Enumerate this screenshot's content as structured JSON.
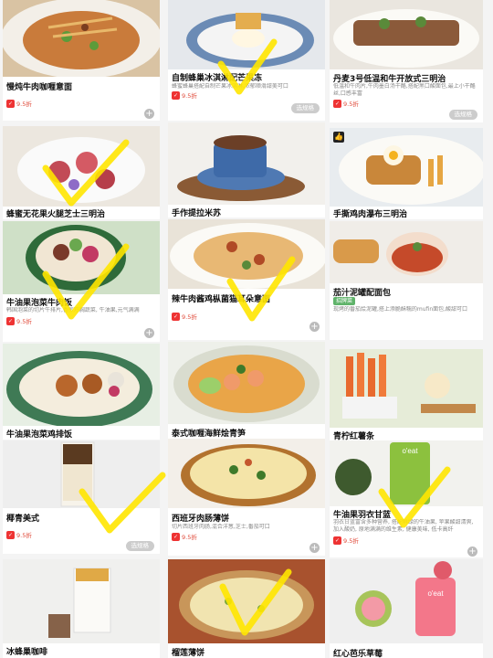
{
  "discount_label": "9.5折",
  "spec_label": "选规格",
  "plus_label": "+",
  "col0": [
    {
      "name": "慢炖牛肉咖喱意面"
    },
    {
      "name": "蜂蜜无花果火腿芝士三明治"
    },
    {
      "name": "牛油果泡菜牛肉饭",
      "desc": "韩国泡菜的切片牛排片,香煎鸡胸蔬菜, 牛油果,元气满满"
    },
    {
      "name": "牛油果泡菜鸡排饭"
    },
    {
      "name": "椰青美式"
    },
    {
      "name": "冰蜂巢咖啡"
    }
  ],
  "col1": [
    {
      "name": "自制蜂巢冰淇淋配芒果冻",
      "desc": "蜂蜜蜂巢搭配自制芒果冰淇淋,浓郁顺滑甜美可口"
    },
    {
      "name": "手作提拉米苏"
    },
    {
      "name": "辣牛肉酱鸡枞菌猫耳朵意面"
    },
    {
      "name": "泰式咖喱海鲜烩青笋"
    },
    {
      "name": "西班牙肉肠薄饼",
      "desc": "切片西班牙肉肠,混合洋葱,芝士,番茄可口"
    },
    {
      "name": "榴莲薄饼"
    }
  ],
  "col2": [
    {
      "name": "丹麦3号低温和牛开放式三明治",
      "desc": "低温和牛肉片,牛肉墨白汤干酪,搭配黑口酸面包,最上小干酪丝,口感丰富"
    },
    {
      "name": "手撕鸡肉瀑布三明治"
    },
    {
      "name": "茄汁泥罐配面包",
      "badge": "招牌菜",
      "desc": "现烤的番茄烩泥罐,搭上添脆酥糯的mufin面包,酸甜可口"
    },
    {
      "name": "青柠红薯条"
    },
    {
      "name": "牛油果羽衣甘蓝",
      "desc": "羽衣甘蓝富含多种营养, 搭配鲜绿的牛油果, 苹果酸甜清爽, 加入酸奶, 原地满满的维生素, 健康美味, 低卡高纤"
    },
    {
      "name": "红心芭乐草莓"
    }
  ],
  "colors": {
    "accent_red": "#e33",
    "check_yellow": "#ffe600",
    "plus_gray": "#bbb"
  }
}
